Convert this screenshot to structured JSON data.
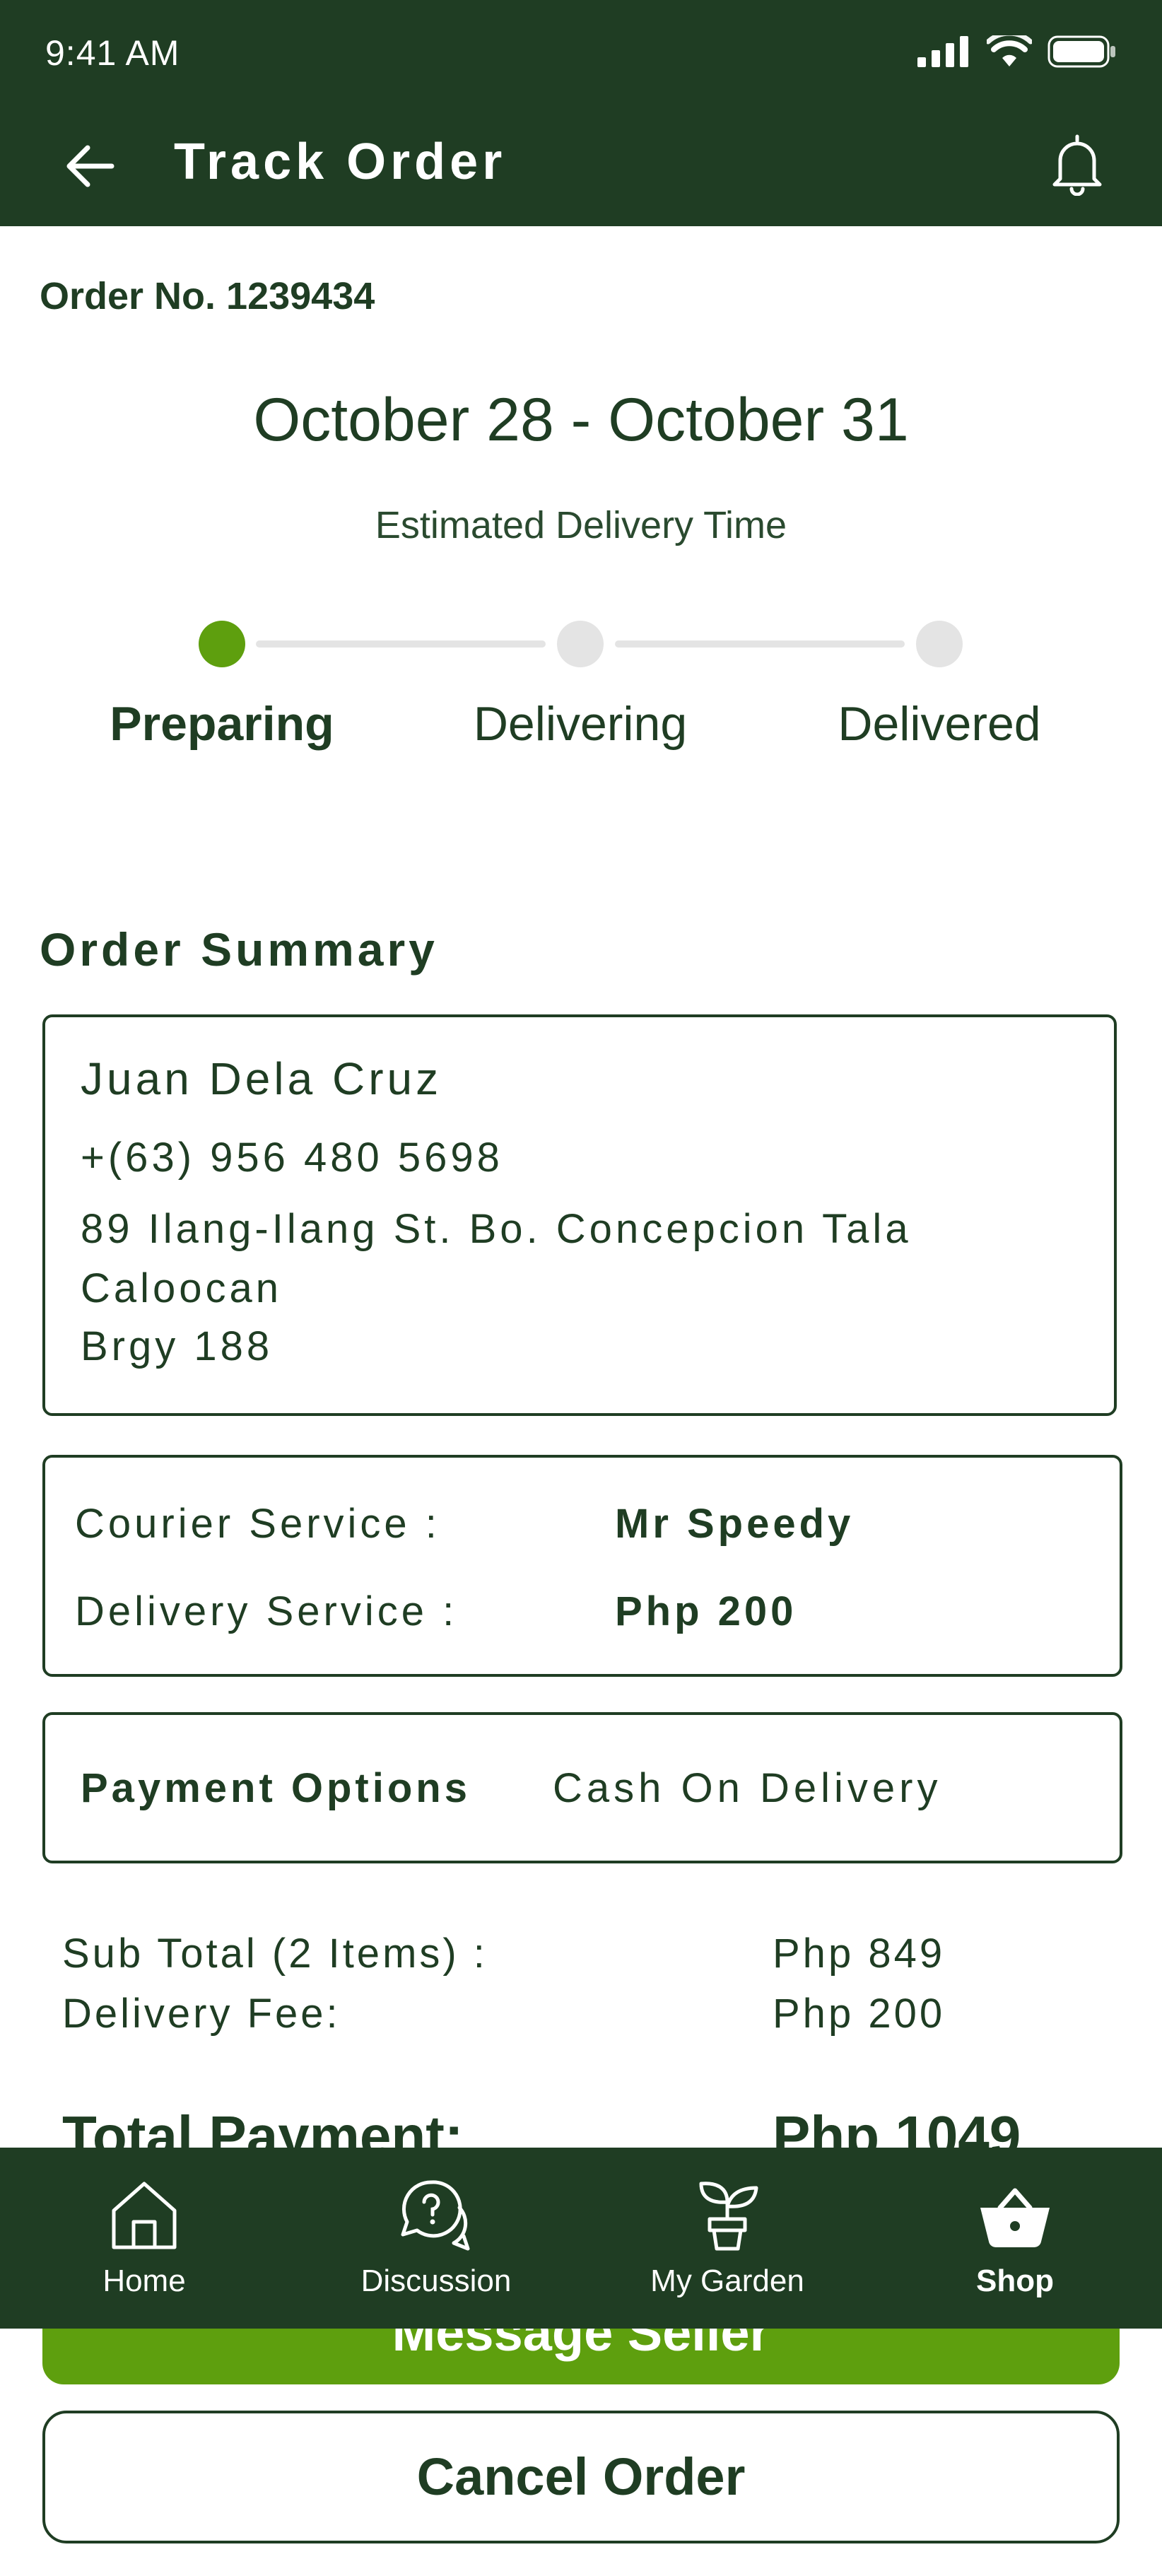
{
  "status_bar": {
    "time": "9:41 AM"
  },
  "header": {
    "title": "Track Order"
  },
  "order": {
    "number_label": "Order No. 1239434",
    "date_range": "October 28 - October 31",
    "eta_label": "Estimated Delivery Time"
  },
  "progress": {
    "current_step": 1,
    "steps": [
      {
        "label": "Preparing"
      },
      {
        "label": "Delivering"
      },
      {
        "label": "Delivered"
      }
    ]
  },
  "summary": {
    "title": "Order Summary",
    "customer": {
      "name": "Juan Dela Cruz",
      "phone": "+(63) 956 480 5698",
      "address_line1": "89 Ilang-Ilang St. Bo. Concepcion Tala Caloocan",
      "address_line2": "Brgy 188"
    },
    "courier": {
      "courier_label": "Courier Service :",
      "courier_value": "Mr Speedy",
      "delivery_label": "Delivery Service :",
      "delivery_value": "Php 200"
    },
    "payment": {
      "label": "Payment Options",
      "value": "Cash On Delivery"
    },
    "totals": {
      "subtotal_label": "Sub Total (2 Items) :",
      "subtotal_value": "Php 849",
      "fee_label": "Delivery Fee:",
      "fee_value": "Php 200",
      "total_label": "Total Payment:",
      "total_value": "Php 1049"
    }
  },
  "actions": {
    "message_label": "Message Seller",
    "cancel_label": "Cancel Order"
  },
  "nav": {
    "active": "Shop",
    "items": [
      {
        "label": "Home",
        "icon": "home-icon"
      },
      {
        "label": "Discussion",
        "icon": "chat-question-icon"
      },
      {
        "label": "My Garden",
        "icon": "plant-pot-icon"
      },
      {
        "label": "Shop",
        "icon": "basket-icon"
      }
    ]
  },
  "colors": {
    "primary_dark": "#1f3d23",
    "accent_green": "#5e9f0e",
    "inactive_step": "#e4e4e4"
  }
}
